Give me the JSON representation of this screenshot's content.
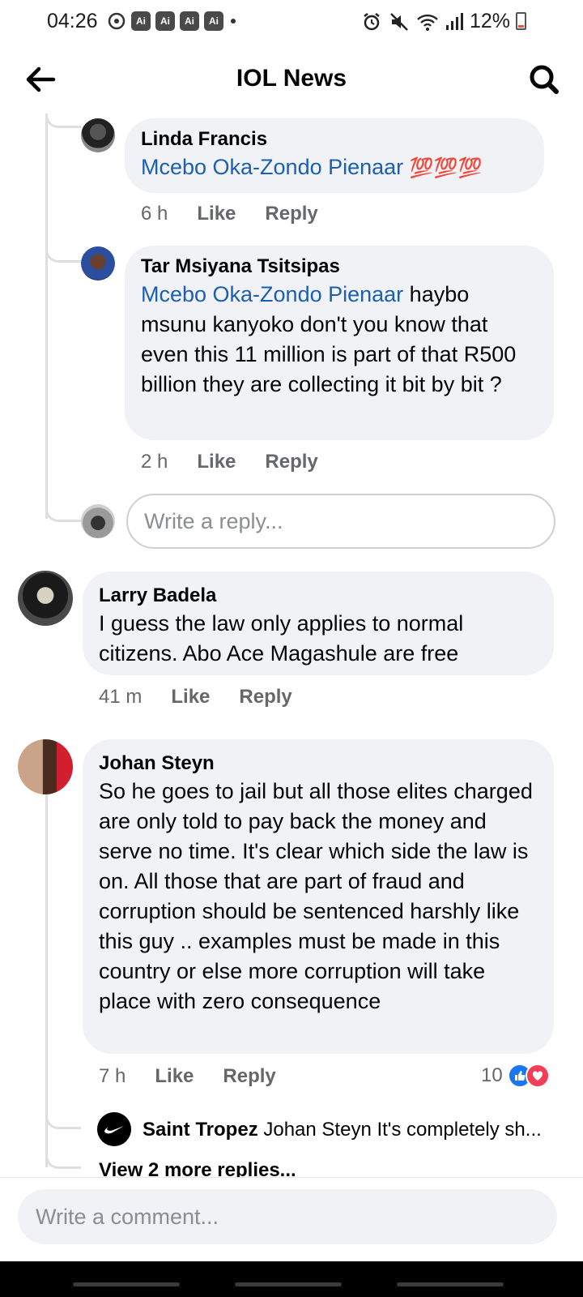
{
  "status_bar": {
    "time": "04:26",
    "ai_badges": [
      "Ai",
      "Ai",
      "Ai",
      "Ai"
    ],
    "battery": "12%"
  },
  "header": {
    "title": "IOL News"
  },
  "comments": [
    {
      "author": "Linda Francis",
      "mention": "Mcebo Oka-Zondo Pienaar",
      "text": "💯💯💯",
      "time": "6 h",
      "like_label": "Like",
      "reply_label": "Reply"
    },
    {
      "author": "Tar Msiyana Tsitsipas",
      "mention": "Mcebo Oka-Zondo Pienaar",
      "text": " haybo msunu kanyoko don't you know that even this 11 million is part of that R500 billion they are collecting it bit by bit ?",
      "time": "2 h",
      "like_label": "Like",
      "reply_label": "Reply"
    },
    {
      "author": "Larry Badela",
      "text": "I guess the law only applies to normal citizens. Abo Ace Magashule are free",
      "time": "41 m",
      "like_label": "Like",
      "reply_label": "Reply"
    },
    {
      "author": "Johan Steyn",
      "text": "So he goes to jail but all those elites charged are only told to pay back the money and serve no time. It's clear which side the law is on. All those that are part of fraud and corruption should be sentenced harshly like this guy .. examples must be made in this country or else more corruption will take place with zero consequence",
      "time": "7 h",
      "like_label": "Like",
      "reply_label": "Reply",
      "reaction_count": "10"
    }
  ],
  "reply_input": {
    "placeholder": "Write a reply..."
  },
  "preview_reply": {
    "author": "Saint Tropez",
    "text": "Johan Steyn It's completely sh..."
  },
  "view_more": "View 2 more replies...",
  "comment_input": {
    "placeholder": "Write a comment..."
  }
}
